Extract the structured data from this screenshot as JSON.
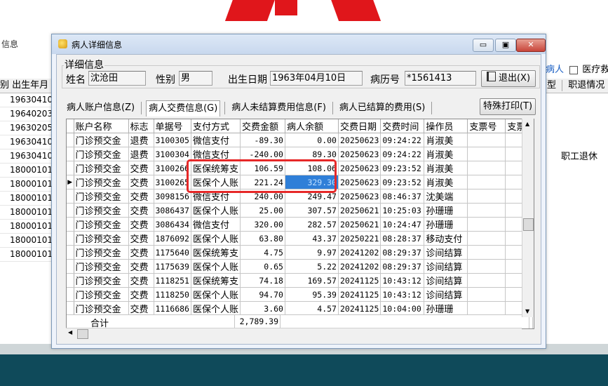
{
  "background": {
    "left_title": "信息",
    "left_header": "别 出生年月",
    "left_rows": [
      "19630410",
      "19640203",
      "19630205",
      "19630410",
      "19630410",
      "18000101",
      "18000101",
      "18000101",
      "18000101",
      "18000101",
      "18000101",
      "18000101"
    ],
    "right_top_text": "病人",
    "right_top_checkbox_label": "医疗救助",
    "right_header_1": "型",
    "right_header_2": "职退情况",
    "right_row_value": "职工退休"
  },
  "dialog": {
    "title": "病人详细信息",
    "controls": {
      "minimize": "▭",
      "restore": "▣",
      "close": "✕"
    }
  },
  "info": {
    "legend": "详细信息",
    "name_label": "姓名",
    "name_value": "沈沧田",
    "gender_label": "性别",
    "gender_value": "男",
    "birth_label": "出生日期",
    "birth_value": "1963年04月10日",
    "record_label": "病历号",
    "record_value": "*1561413",
    "exit_button": "退出(X)"
  },
  "tabs": [
    {
      "label": "病人账户信息(Z)"
    },
    {
      "label": "病人交费信息(G)"
    },
    {
      "label": "病人未结算费用信息(F)"
    },
    {
      "label": "病人已结算的费用(S)"
    }
  ],
  "special_print_button": "特殊打印(T)",
  "table": {
    "columns": [
      "账户名称",
      "标志",
      "单据号",
      "支付方式",
      "交费金额",
      "病人余额",
      "交费日期",
      "交费时间",
      "操作员",
      "支票号",
      "支票"
    ],
    "rows": [
      [
        "门诊预交金",
        "退费",
        "3100305",
        "微信支付",
        "-89.30",
        "0.00",
        "20250623",
        "09:24:22",
        "肖淑美",
        "",
        ""
      ],
      [
        "门诊预交金",
        "退费",
        "3100304",
        "微信支付",
        "-240.00",
        "89.30",
        "20250623",
        "09:24:22",
        "肖淑美",
        "",
        ""
      ],
      [
        "门诊预交金",
        "交费",
        "3100266",
        "医保统筹支",
        "106.59",
        "108.06",
        "20250623",
        "09:23:52",
        "肖淑美",
        "",
        ""
      ],
      [
        "门诊预交金",
        "交费",
        "3100265",
        "医保个人账",
        "221.24",
        "329.30",
        "20250623",
        "09:23:52",
        "肖淑美",
        "",
        ""
      ],
      [
        "门诊预交金",
        "交费",
        "3098156",
        "微信支付",
        "240.00",
        "249.47",
        "20250623",
        "08:46:37",
        "沈美端",
        "",
        ""
      ],
      [
        "门诊预交金",
        "交费",
        "3086437",
        "医保个人账",
        "25.00",
        "307.57",
        "20250621",
        "10:25:03",
        "孙珊珊",
        "",
        ""
      ],
      [
        "门诊预交金",
        "交费",
        "3086434",
        "微信支付",
        "320.00",
        "282.57",
        "20250621",
        "10:24:47",
        "孙珊珊",
        "",
        ""
      ],
      [
        "门诊预交金",
        "交费",
        "1876092",
        "医保个人账",
        "63.80",
        "43.37",
        "20250221",
        "08:28:37",
        "移动支付",
        "",
        ""
      ],
      [
        "门诊预交金",
        "交费",
        "1175640",
        "医保统筹支",
        "4.75",
        "9.97",
        "20241202",
        "08:29:37",
        "诊间结算",
        "",
        ""
      ],
      [
        "门诊预交金",
        "交费",
        "1175639",
        "医保个人账",
        "0.65",
        "5.22",
        "20241202",
        "08:29:37",
        "诊间结算",
        "",
        ""
      ],
      [
        "门诊预交金",
        "交费",
        "1118251",
        "医保统筹支",
        "74.18",
        "169.57",
        "20241125",
        "10:43:12",
        "诊间结算",
        "",
        ""
      ],
      [
        "门诊预交金",
        "交费",
        "1118250",
        "医保个人账",
        "94.70",
        "95.39",
        "20241125",
        "10:43:12",
        "诊间结算",
        "",
        ""
      ],
      [
        "门诊预交金",
        "交费",
        "1116686",
        "医保个人账",
        "3.60",
        "4.57",
        "20241125",
        "10:04:00",
        "孙珊珊",
        "",
        ""
      ]
    ],
    "total_label": "合计",
    "total_value": "2,789.39",
    "selected_row_marker": "▶"
  },
  "colors": {
    "selection": "#2f7fd8",
    "highlight_box": "#e62828",
    "title_bar": "#c8d8ee"
  }
}
